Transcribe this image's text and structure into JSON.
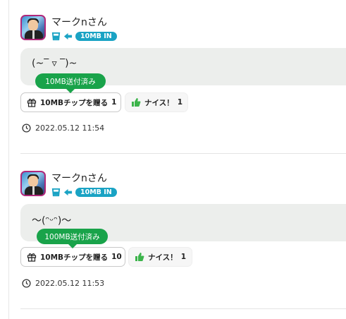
{
  "posts": [
    {
      "username": "マークnさん",
      "mb_badge": "10MB IN",
      "message": "(~‾ ▿ ‾)~",
      "tooltip": "10MB送付済み",
      "tip_button_label": "10MBチップを贈る",
      "tip_count": "1",
      "nice_label": "ナイス！",
      "nice_count": "1",
      "timestamp": "2022.05.12 11:54"
    },
    {
      "username": "マークnさん",
      "mb_badge": "10MB IN",
      "message": "～(ᵔᵕᵔ)～",
      "tooltip": "100MB送付済み",
      "tip_button_label": "10MBチップを贈る",
      "tip_count": "10",
      "nice_label": "ナイス！",
      "nice_count": "1",
      "timestamp": "2022.05.12 11:53"
    }
  ],
  "colors": {
    "badge": "#1aa3c4",
    "tooltip": "#19a34a",
    "thumb": "#3cb44b",
    "avatar_border": "#b0287a",
    "bubble": "#eceeec"
  },
  "icons": [
    "cup-icon",
    "arrow-left-icon",
    "gift-icon",
    "thumbs-up-icon",
    "clock-icon"
  ]
}
